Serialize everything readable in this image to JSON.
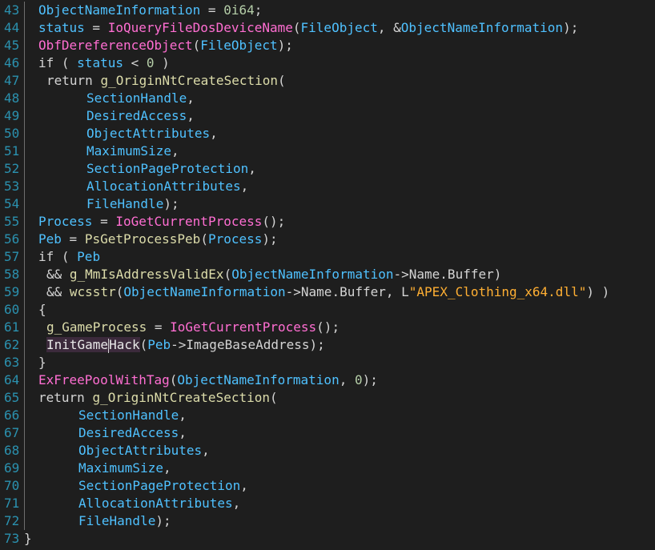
{
  "editor": {
    "colors": {
      "background": "#1e1e1e",
      "line_number": "#2b91af",
      "identifier": "#4fc1ff",
      "function_call": "#ff6ed2",
      "global_function": "#dcdcaa",
      "string": "#ffaf33",
      "number": "#b5cea8",
      "default_text": "#d4d4d4"
    },
    "lines": [
      {
        "num": "43",
        "fold": true,
        "indent": 1,
        "tokens": [
          {
            "t": "ObjectNameInformation",
            "k": "identifier"
          },
          {
            "t": " = ",
            "k": "op"
          },
          {
            "t": "0i64",
            "k": "number"
          },
          {
            "t": ";",
            "k": "op"
          }
        ]
      },
      {
        "num": "44",
        "fold": true,
        "indent": 1,
        "tokens": [
          {
            "t": "status",
            "k": "identifier"
          },
          {
            "t": " = ",
            "k": "op"
          },
          {
            "t": "IoQueryFileDosDeviceName",
            "k": "function"
          },
          {
            "t": "(",
            "k": "op"
          },
          {
            "t": "FileObject",
            "k": "identifier"
          },
          {
            "t": ", &",
            "k": "op"
          },
          {
            "t": "ObjectNameInformation",
            "k": "identifier"
          },
          {
            "t": ");",
            "k": "op"
          }
        ]
      },
      {
        "num": "45",
        "fold": true,
        "indent": 1,
        "tokens": [
          {
            "t": "ObfDereferenceObject",
            "k": "function"
          },
          {
            "t": "(",
            "k": "op"
          },
          {
            "t": "FileObject",
            "k": "identifier"
          },
          {
            "t": ");",
            "k": "op"
          }
        ]
      },
      {
        "num": "46",
        "fold": true,
        "indent": 1,
        "tokens": [
          {
            "t": "if",
            "k": "keyword"
          },
          {
            "t": " ( ",
            "k": "op"
          },
          {
            "t": "status",
            "k": "identifier"
          },
          {
            "t": " < ",
            "k": "op"
          },
          {
            "t": "0",
            "k": "number"
          },
          {
            "t": " )",
            "k": "op"
          }
        ]
      },
      {
        "num": "47",
        "fold": true,
        "indent": 2,
        "tokens": [
          {
            "t": "return",
            "k": "keyword"
          },
          {
            "t": " ",
            "k": "op"
          },
          {
            "t": "g_OriginNtCreateSection",
            "k": "global"
          },
          {
            "t": "(",
            "k": "op"
          }
        ]
      },
      {
        "num": "48",
        "fold": true,
        "indent": 7,
        "tokens": [
          {
            "t": "SectionHandle",
            "k": "identifier"
          },
          {
            "t": ",",
            "k": "op"
          }
        ]
      },
      {
        "num": "49",
        "fold": true,
        "indent": 7,
        "tokens": [
          {
            "t": "DesiredAccess",
            "k": "identifier"
          },
          {
            "t": ",",
            "k": "op"
          }
        ]
      },
      {
        "num": "50",
        "fold": true,
        "indent": 7,
        "tokens": [
          {
            "t": "ObjectAttributes",
            "k": "identifier"
          },
          {
            "t": ",",
            "k": "op"
          }
        ]
      },
      {
        "num": "51",
        "fold": true,
        "indent": 7,
        "tokens": [
          {
            "t": "MaximumSize",
            "k": "identifier"
          },
          {
            "t": ",",
            "k": "op"
          }
        ]
      },
      {
        "num": "52",
        "fold": true,
        "indent": 7,
        "tokens": [
          {
            "t": "SectionPageProtection",
            "k": "identifier"
          },
          {
            "t": ",",
            "k": "op"
          }
        ]
      },
      {
        "num": "53",
        "fold": true,
        "indent": 7,
        "tokens": [
          {
            "t": "AllocationAttributes",
            "k": "identifier"
          },
          {
            "t": ",",
            "k": "op"
          }
        ]
      },
      {
        "num": "54",
        "fold": true,
        "indent": 7,
        "tokens": [
          {
            "t": "FileHandle",
            "k": "identifier"
          },
          {
            "t": ");",
            "k": "op"
          }
        ]
      },
      {
        "num": "55",
        "fold": true,
        "indent": 1,
        "tokens": [
          {
            "t": "Process",
            "k": "identifier"
          },
          {
            "t": " = ",
            "k": "op"
          },
          {
            "t": "IoGetCurrentProcess",
            "k": "function"
          },
          {
            "t": "();",
            "k": "op"
          }
        ]
      },
      {
        "num": "56",
        "fold": true,
        "indent": 1,
        "tokens": [
          {
            "t": "Peb",
            "k": "identifier"
          },
          {
            "t": " = ",
            "k": "op"
          },
          {
            "t": "PsGetProcessPeb",
            "k": "global"
          },
          {
            "t": "(",
            "k": "op"
          },
          {
            "t": "Process",
            "k": "identifier"
          },
          {
            "t": ");",
            "k": "op"
          }
        ]
      },
      {
        "num": "57",
        "fold": true,
        "indent": 1,
        "tokens": [
          {
            "t": "if",
            "k": "keyword"
          },
          {
            "t": " ( ",
            "k": "op"
          },
          {
            "t": "Peb",
            "k": "identifier"
          }
        ]
      },
      {
        "num": "58",
        "fold": true,
        "indent": 2,
        "tokens": [
          {
            "t": "&& ",
            "k": "op"
          },
          {
            "t": "g_MmIsAddressValidEx",
            "k": "global"
          },
          {
            "t": "(",
            "k": "op"
          },
          {
            "t": "ObjectNameInformation",
            "k": "identifier"
          },
          {
            "t": "->Name.Buffer)",
            "k": "op"
          }
        ]
      },
      {
        "num": "59",
        "fold": true,
        "indent": 2,
        "tokens": [
          {
            "t": "&& ",
            "k": "op"
          },
          {
            "t": "wcsstr",
            "k": "global"
          },
          {
            "t": "(",
            "k": "op"
          },
          {
            "t": "ObjectNameInformation",
            "k": "identifier"
          },
          {
            "t": "->Name.Buffer, ",
            "k": "op"
          },
          {
            "t": "L",
            "k": "string-prefix"
          },
          {
            "t": "\"APEX_Clothing_x64.dll\"",
            "k": "string"
          },
          {
            "t": ") )",
            "k": "op"
          }
        ]
      },
      {
        "num": "60",
        "fold": true,
        "indent": 1,
        "tokens": [
          {
            "t": "{",
            "k": "op"
          }
        ]
      },
      {
        "num": "61",
        "fold": true,
        "indent": 2,
        "tokens": [
          {
            "t": "g_GameProcess",
            "k": "global"
          },
          {
            "t": " = ",
            "k": "op"
          },
          {
            "t": "IoGetCurrentProcess",
            "k": "function"
          },
          {
            "t": "();",
            "k": "op"
          }
        ]
      },
      {
        "num": "62",
        "fold": true,
        "indent": 2,
        "cursor_after": 8,
        "tokens": [
          {
            "t": "InitGameHack",
            "k": "func-def"
          },
          {
            "t": "(",
            "k": "op"
          },
          {
            "t": "Peb",
            "k": "identifier"
          },
          {
            "t": "->ImageBaseAddress);",
            "k": "op"
          }
        ]
      },
      {
        "num": "63",
        "fold": true,
        "indent": 1,
        "tokens": [
          {
            "t": "}",
            "k": "op"
          }
        ]
      },
      {
        "num": "64",
        "fold": true,
        "indent": 1,
        "tokens": [
          {
            "t": "ExFreePoolWithTag",
            "k": "function"
          },
          {
            "t": "(",
            "k": "op"
          },
          {
            "t": "ObjectNameInformation",
            "k": "identifier"
          },
          {
            "t": ", ",
            "k": "op"
          },
          {
            "t": "0",
            "k": "number"
          },
          {
            "t": ");",
            "k": "op"
          }
        ]
      },
      {
        "num": "65",
        "fold": true,
        "indent": 1,
        "tokens": [
          {
            "t": "return",
            "k": "keyword"
          },
          {
            "t": " ",
            "k": "op"
          },
          {
            "t": "g_OriginNtCreateSection",
            "k": "global"
          },
          {
            "t": "(",
            "k": "op"
          }
        ]
      },
      {
        "num": "66",
        "fold": true,
        "indent": 6,
        "tokens": [
          {
            "t": "SectionHandle",
            "k": "identifier"
          },
          {
            "t": ",",
            "k": "op"
          }
        ]
      },
      {
        "num": "67",
        "fold": true,
        "indent": 6,
        "tokens": [
          {
            "t": "DesiredAccess",
            "k": "identifier"
          },
          {
            "t": ",",
            "k": "op"
          }
        ]
      },
      {
        "num": "68",
        "fold": true,
        "indent": 6,
        "tokens": [
          {
            "t": "ObjectAttributes",
            "k": "identifier"
          },
          {
            "t": ",",
            "k": "op"
          }
        ]
      },
      {
        "num": "69",
        "fold": true,
        "indent": 6,
        "tokens": [
          {
            "t": "MaximumSize",
            "k": "identifier"
          },
          {
            "t": ",",
            "k": "op"
          }
        ]
      },
      {
        "num": "70",
        "fold": true,
        "indent": 6,
        "tokens": [
          {
            "t": "SectionPageProtection",
            "k": "identifier"
          },
          {
            "t": ",",
            "k": "op"
          }
        ]
      },
      {
        "num": "71",
        "fold": true,
        "indent": 6,
        "tokens": [
          {
            "t": "AllocationAttributes",
            "k": "identifier"
          },
          {
            "t": ",",
            "k": "op"
          }
        ]
      },
      {
        "num": "72",
        "fold": true,
        "indent": 6,
        "tokens": [
          {
            "t": "FileHandle",
            "k": "identifier"
          },
          {
            "t": ");",
            "k": "op"
          }
        ]
      },
      {
        "num": "73",
        "fold": false,
        "indent": 0,
        "tokens": [
          {
            "t": "}",
            "k": "op"
          }
        ]
      }
    ]
  }
}
